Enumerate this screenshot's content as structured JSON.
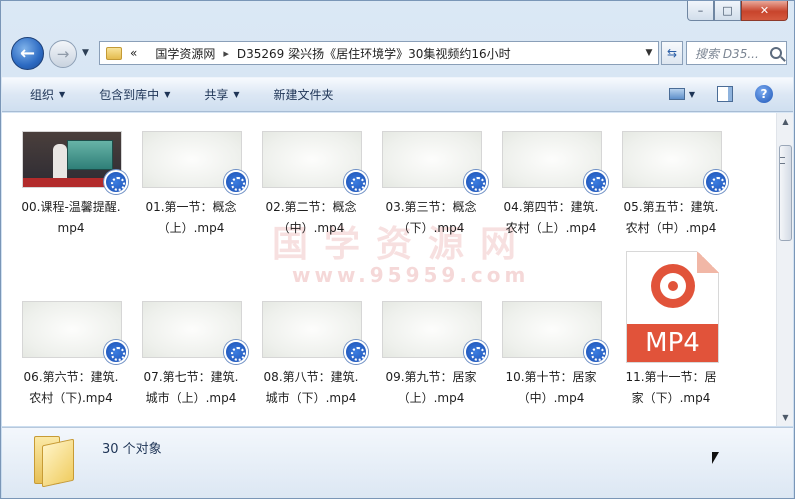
{
  "window": {
    "buttons": {
      "minimize": "–",
      "maximize": "□",
      "close": "✕"
    }
  },
  "nav": {
    "back_icon": "back-arrow-icon",
    "forward_icon": "forward-arrow-icon",
    "dropdown_icon": "chevron-down-icon"
  },
  "address": {
    "prefix": "«",
    "crumbs": [
      "国学资源网",
      "D35269 梁兴扬《居住环境学》30集视频约16小时"
    ],
    "separator": "▸"
  },
  "search": {
    "placeholder": "搜索 D35..."
  },
  "toolbar": {
    "organize": "组织",
    "include_library": "包含到库中",
    "share": "共享",
    "new_folder": "新建文件夹"
  },
  "watermark": {
    "main": "国学资源网",
    "url": "www.95959.com"
  },
  "files": [
    {
      "name_line1": "00.课程-温馨提醒.",
      "name_line2": "mp4",
      "thumb": "video"
    },
    {
      "name_line1": "01.第一节：概念",
      "name_line2": "（上）.mp4",
      "thumb": "blank"
    },
    {
      "name_line1": "02.第二节：概念",
      "name_line2": "（中）.mp4",
      "thumb": "blank"
    },
    {
      "name_line1": "03.第三节：概念",
      "name_line2": "（下）.mp4",
      "thumb": "blank"
    },
    {
      "name_line1": "04.第四节：建筑.",
      "name_line2": "农村（上）.mp4",
      "thumb": "blank"
    },
    {
      "name_line1": "05.第五节：建筑.",
      "name_line2": "农村（中）.mp4",
      "thumb": "blank"
    },
    {
      "name_line1": "06.第六节：建筑.",
      "name_line2": "农村（下).mp4",
      "thumb": "blank"
    },
    {
      "name_line1": "07.第七节：建筑.",
      "name_line2": "城市（上）.mp4",
      "thumb": "blank"
    },
    {
      "name_line1": "08.第八节：建筑.",
      "name_line2": "城市（下）.mp4",
      "thumb": "blank"
    },
    {
      "name_line1": "09.第九节：居家",
      "name_line2": "（上）.mp4",
      "thumb": "blank"
    },
    {
      "name_line1": "10.第十节：居家",
      "name_line2": "（中）.mp4",
      "thumb": "blank"
    },
    {
      "name_line1": "11.第十一节：居",
      "name_line2": "家（下）.mp4",
      "thumb": "mp4icon"
    }
  ],
  "mp4_icon_text": "MP4",
  "status": {
    "count_text": "30 个对象"
  }
}
